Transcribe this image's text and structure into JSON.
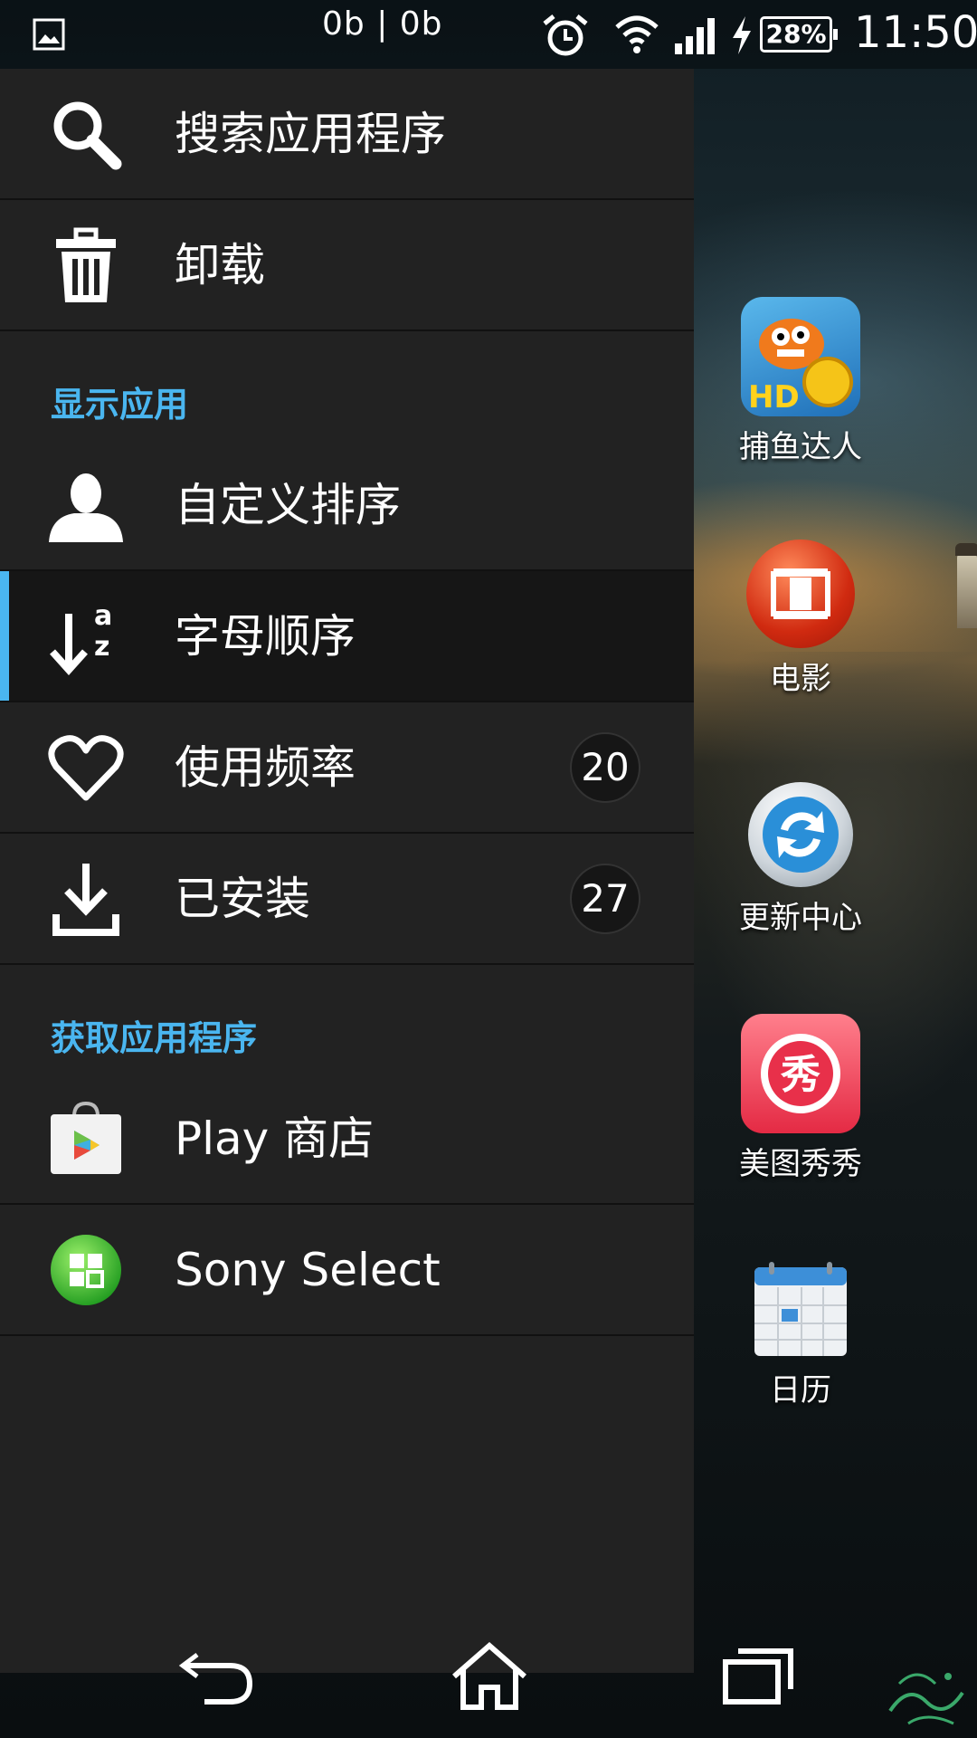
{
  "status_bar": {
    "traffic": "0b | 0b",
    "battery": "28%",
    "time": "11:50"
  },
  "menu": {
    "search": "搜索应用程序",
    "uninstall": "卸载",
    "section_show": "显示应用",
    "custom_sort": "自定义排序",
    "alphabetical": "字母顺序",
    "most_used": "使用频率",
    "most_used_count": "20",
    "installed": "已安装",
    "installed_count": "27",
    "section_get": "获取应用程序",
    "play_store": "Play 商店",
    "sony_select": "Sony Select"
  },
  "desktop_apps": [
    {
      "name": "捕鱼达人",
      "icon": "fishing-game-icon"
    },
    {
      "name": "电影",
      "icon": "movie-icon"
    },
    {
      "name": "更新中心",
      "icon": "update-center-icon"
    },
    {
      "name": "美图秀秀",
      "icon": "meitu-icon"
    },
    {
      "name": "日历",
      "icon": "calendar-icon"
    }
  ],
  "meitu_glyph": "秀",
  "colors": {
    "accent": "#4ab6f0",
    "drawer": "#222222"
  }
}
